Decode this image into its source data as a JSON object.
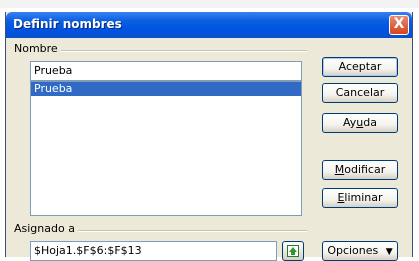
{
  "dialog": {
    "title": "Definir nombres",
    "close_label": "X"
  },
  "name_group": {
    "label": "Nombre",
    "input_value": "Prueba",
    "items": [
      "Prueba"
    ]
  },
  "ref_group": {
    "label": "Asignado a",
    "input_value": "$Hoja1.$F$6:$F$13"
  },
  "buttons": {
    "ok": "Aceptar",
    "cancel": "Cancelar",
    "help": {
      "pre": "Ay",
      "key": "u",
      "post": "da"
    },
    "modify": {
      "pre": "",
      "key": "M",
      "post": "odificar"
    },
    "delete": {
      "pre": "",
      "key": "E",
      "post": "liminar"
    },
    "options": "Opciones",
    "options_arrow": "▼"
  },
  "colors": {
    "titlebar": "#0a5fe0",
    "selection": "#316ac5",
    "dialog_bg": "#ece9d8"
  }
}
